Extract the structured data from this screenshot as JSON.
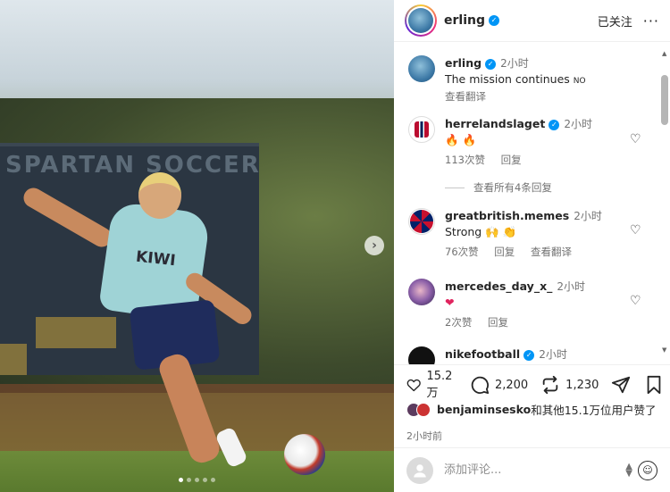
{
  "post": {
    "author": "erling",
    "follow_status": "已关注",
    "more": "···",
    "carousel_next": "›",
    "photo_caption_text": {
      "board": "SPARTAN SOCCER",
      "shirt": "KIWI"
    }
  },
  "caption": {
    "username": "erling",
    "time": "2小时",
    "text": "The mission continues",
    "flag": "NO",
    "translate": "查看翻译"
  },
  "comments": [
    {
      "username": "herrelandslaget",
      "time": "2小时",
      "text": "🔥 🔥",
      "likes": "113次赞",
      "reply": "回复",
      "translate": "",
      "verified": true
    },
    {
      "username": "greatbritish.memes",
      "time": "2小时",
      "text": "Strong 🙌 👏",
      "likes": "76次赞",
      "reply": "回复",
      "translate": "查看翻译",
      "verified": false
    },
    {
      "username": "mercedes_day_x_",
      "time": "2小时",
      "text": "❤",
      "likes": "2次赞",
      "reply": "回复",
      "translate": "",
      "verified": false
    },
    {
      "username": "nikefootball",
      "time": "2小时",
      "text": "",
      "likes": "",
      "reply": "",
      "translate": "",
      "verified": true
    }
  ],
  "view_all_replies": "查看所有4条回复",
  "actions": {
    "likes_count": "15.2 万",
    "comments_count": "2,200",
    "reposts_count": "1,230"
  },
  "liked_by": {
    "user": "benjaminsesko",
    "suffix": "和其他15.1万位用户赞了"
  },
  "posted_time": "2小时前",
  "add_comment": {
    "placeholder": "添加评论..."
  },
  "colors": {
    "verified": "#0095f6",
    "text": "#262626",
    "muted": "#737373"
  }
}
